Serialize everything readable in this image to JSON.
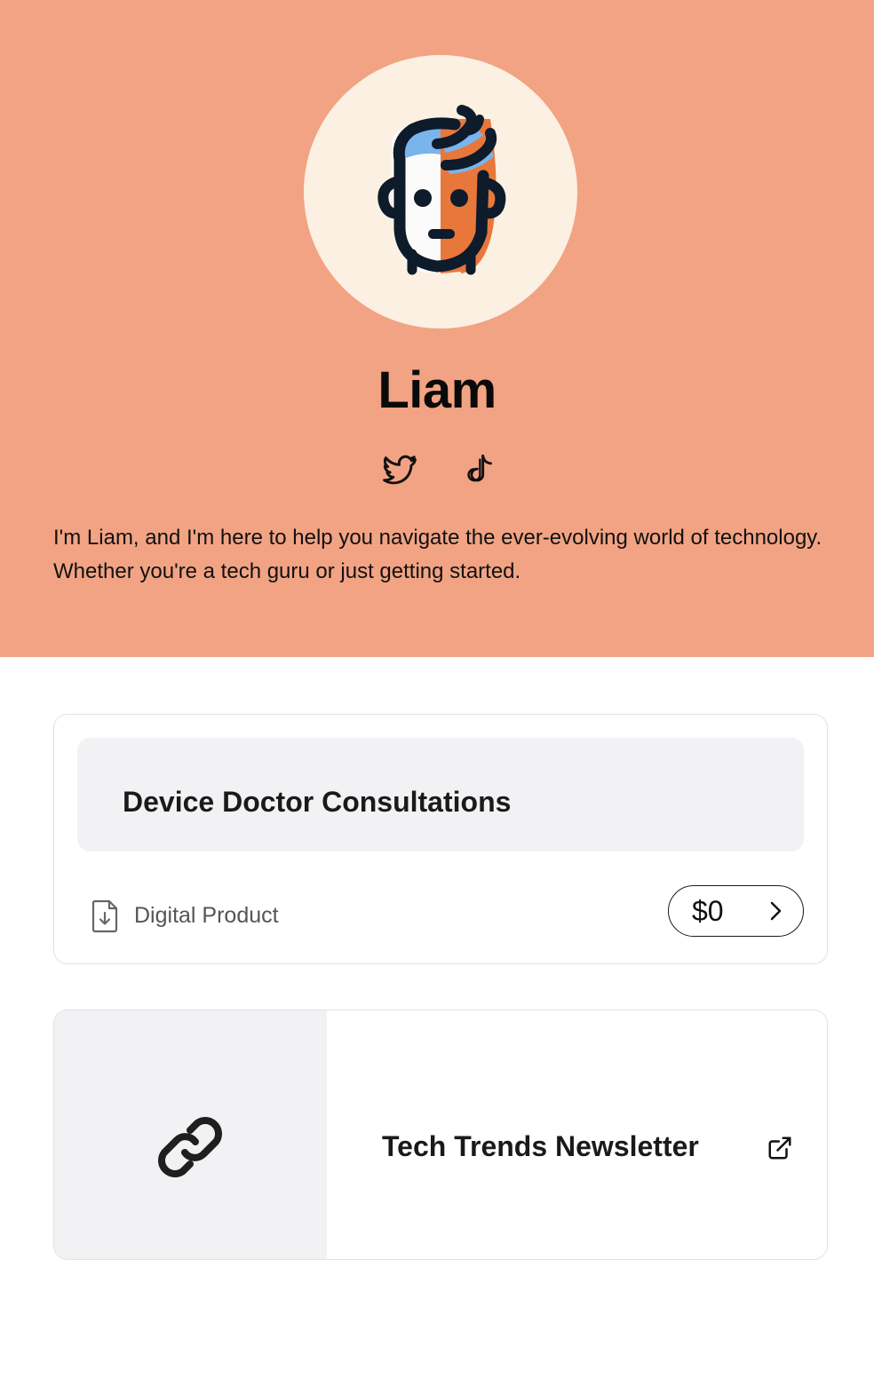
{
  "profile": {
    "name": "Liam",
    "bio": "I'm Liam, and I'm here to help you navigate the ever-evolving world of technology. Whether you're a tech guru or just getting started.",
    "avatar": "cartoon-face-avatar",
    "socials": [
      {
        "platform": "Twitter",
        "icon": "twitter-icon"
      },
      {
        "platform": "TikTok",
        "icon": "tiktok-icon"
      }
    ]
  },
  "product_card": {
    "title": "Device Doctor Consultations",
    "type_label": "Digital Product",
    "type_icon": "file-download-icon",
    "price": "$0",
    "action_icon": "chevron-right-icon"
  },
  "link_card": {
    "title": "Tech Trends Newsletter",
    "thumb_icon": "link-icon",
    "action_icon": "external-link-icon"
  },
  "colors": {
    "hero_background": "#F2A383",
    "avatar_background": "#FBF0E2",
    "card_surface": "#F2F2F4",
    "text": "#111111"
  }
}
